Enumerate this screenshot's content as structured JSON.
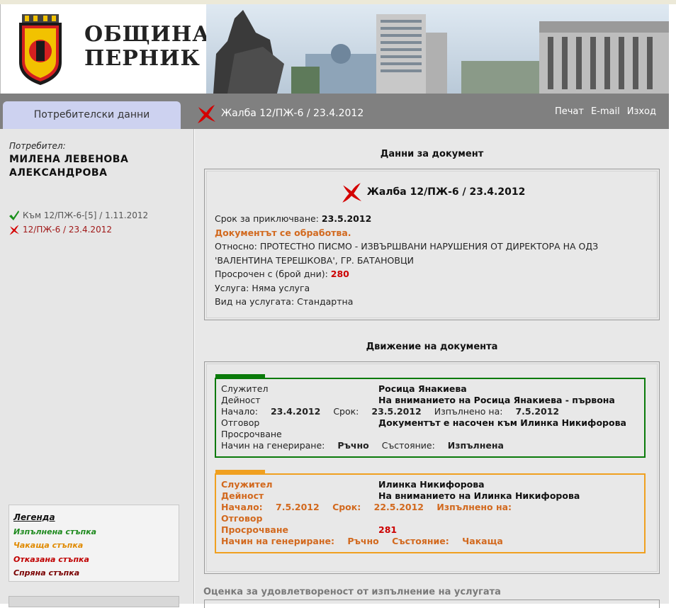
{
  "banner": {
    "title_line1": "ОБЩИНА",
    "title_line2": "ПЕРНИК"
  },
  "topbar": {
    "user_tab": "Потребителски данни",
    "doc_heading": "Жалба 12/ПЖ-6 / 23.4.2012",
    "links": {
      "print": "Печат",
      "email": "E-mail",
      "exit": "Изход"
    }
  },
  "sidebar": {
    "user_label": "Потребител:",
    "user_name": "МИЛЕНА ЛЕВЕНОВА АЛЕКСАНДРОВА",
    "history": [
      {
        "status": "done",
        "text": "Към 12/ПЖ-6-[5] / 1.11.2012"
      },
      {
        "status": "rejected",
        "text": "12/ПЖ-6 / 23.4.2012"
      }
    ],
    "legend": {
      "title": "Легенда",
      "done": "Изпълнена стъпка",
      "waiting": "Чакаща стъпка",
      "rejected": "Отказана стъпка",
      "stopped": "Спряна стъпка"
    }
  },
  "document": {
    "section_title": "Данни за документ",
    "title": "Жалба 12/ПЖ-6 / 23.4.2012",
    "deadline_label": "Срок за приключване:",
    "deadline_value": "23.5.2012",
    "status_text": "Документът се обработва.",
    "subject_label": "Относно:",
    "subject_value": "ПРОТЕСТНО ПИСМО - ИЗВЪРШВАНИ НАРУШЕНИЯ ОТ ДИРЕКТОРА НА ОДЗ 'ВАЛЕНТИНА ТЕРЕШКОВА', ГР. БАТАНОВЦИ",
    "overdue_label": "Просрочен с (брой дни):",
    "overdue_value": "280",
    "service_label": "Услуга:",
    "service_value": "Няма услуга",
    "service_type_label": "Вид на услугата:",
    "service_type_value": "Стандартна"
  },
  "movement": {
    "section_title": "Движение на документа",
    "labels": {
      "employee": "Служител",
      "activity": "Дейност",
      "start": "Начало:",
      "term": "Срок:",
      "done_on": "Изпълнено на:",
      "answer": "Отговор",
      "overdue": "Просрочване",
      "generation": "Начин на генериране:",
      "state": "Състояние:"
    },
    "steps": [
      {
        "employee": "Росица Янакиева",
        "activity": "На вниманието на Росица Янакиева - първона",
        "start": "23.4.2012",
        "term": "23.5.2012",
        "done_on": "7.5.2012",
        "answer": "Документът е насочен към Илинка Никифорова",
        "overdue": "",
        "generation": "Ръчно",
        "state": "Изпълнена"
      },
      {
        "employee": "Илинка Никифорова",
        "activity": "На вниманието на Илинка Никифорова",
        "start": "7.5.2012",
        "term": "22.5.2012",
        "done_on": "",
        "answer": "",
        "overdue": "281",
        "generation": "Ръчно",
        "state": "Чакаща"
      }
    ]
  },
  "rating_title": "Оценка за удовлетвореност от изпълнение на услугата",
  "colors": {
    "topbar": "#808080",
    "user_tab": "#cdd2f0",
    "done_green": "#0a7a0a",
    "waiting_orange": "#f0a020",
    "overdue_red": "#cc0000",
    "status_orange": "#d2691e"
  }
}
